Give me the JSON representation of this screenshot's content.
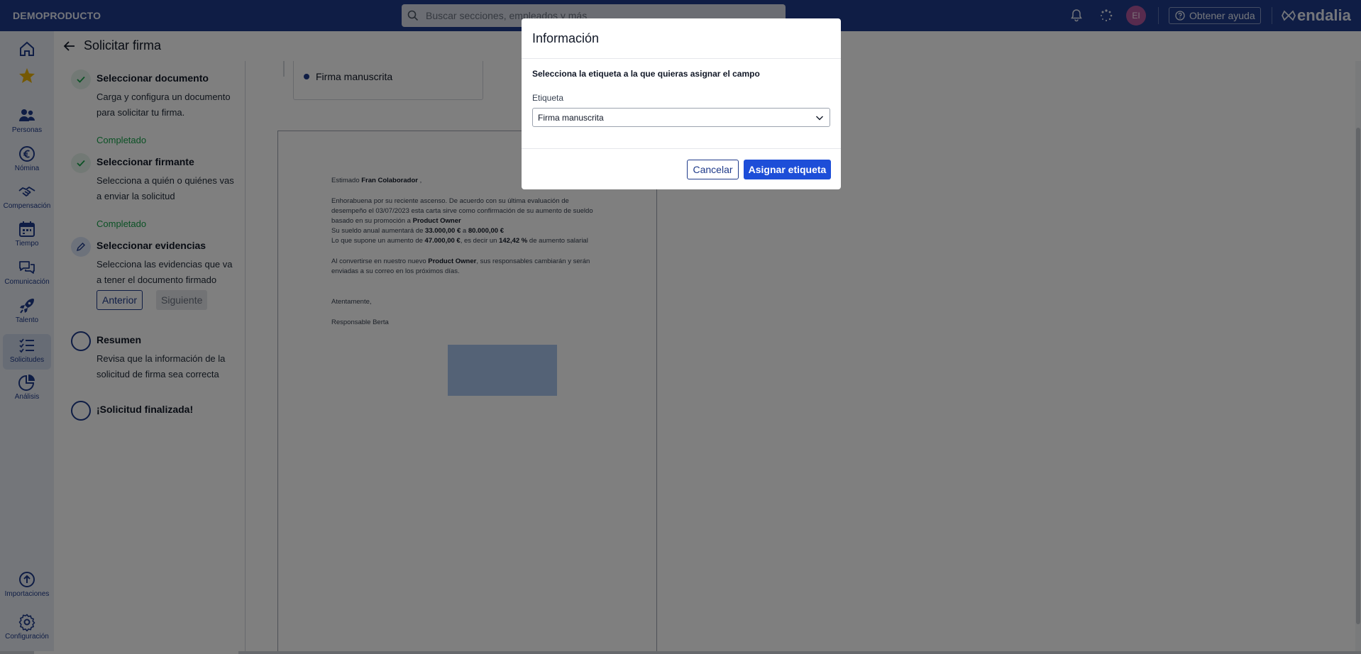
{
  "topbar": {
    "brand": "DEMOPRODUCTO",
    "search_placeholder": "Buscar secciones, empleados y más",
    "avatar_initials": "EI",
    "help_label": "Obtener ayuda",
    "logo_text": "endalia",
    "icons": [
      "search-icon",
      "bell-icon",
      "loading-icon",
      "help-circle-icon",
      "endalia-logo-icon"
    ]
  },
  "nav": {
    "items": [
      {
        "icon": "home-icon",
        "label": ""
      },
      {
        "icon": "star-icon",
        "label": ""
      },
      {
        "icon": "people-icon",
        "label": "Personas"
      },
      {
        "icon": "euro-icon",
        "label": "Nómina"
      },
      {
        "icon": "handshake-icon",
        "label": "Compensación"
      },
      {
        "icon": "calendar-icon",
        "label": "Tiempo"
      },
      {
        "icon": "chat-icon",
        "label": "Comunicación"
      },
      {
        "icon": "rocket-icon",
        "label": "Talento"
      },
      {
        "icon": "checklist-icon",
        "label": "Solicitudes"
      },
      {
        "icon": "pie-chart-icon",
        "label": "Análisis"
      },
      {
        "icon": "upload-icon",
        "label": "Importaciones"
      },
      {
        "icon": "gear-icon",
        "label": "Configuración"
      }
    ],
    "active": "Solicitudes"
  },
  "page": {
    "title": "Solicitar firma"
  },
  "steps": [
    {
      "title": "Seleccionar documento",
      "desc": "Carga y configura un documento para solicitar tu firma.",
      "status": "Completado",
      "state": "done"
    },
    {
      "title": "Seleccionar firmante",
      "desc": "Selecciona a quién o quiénes vas a enviar la solicitud",
      "status": "Completado",
      "state": "done"
    },
    {
      "title": "Seleccionar evidencias",
      "desc": "Selecciona las evidencias que va a tener el documento firmado",
      "state": "current",
      "prev_label": "Anterior",
      "next_label": "Siguiente"
    },
    {
      "title": "Resumen",
      "desc": "Revisa que la información de la solicitud de firma sea correcta",
      "state": "todo"
    },
    {
      "title": "¡Solicitud finalizada!",
      "state": "todo"
    }
  ],
  "content": {
    "tag_item": "Firma manuscrita",
    "document": {
      "greeting_prefix": "Estimado",
      "greeting_name": "Fran Colaborador",
      "greeting_suffix": ",",
      "p1_line1": "Enhorabuena por su reciente ascenso. De acuerdo con su última evaluación de",
      "p1_line2": "desempeño el 03/07/2023 esta carta sirve como confirmación de su aumento de sueldo",
      "p1_line3_prefix": "basado en su promoción a",
      "p1_line3_role": "Product Owner",
      "p1_line4_prefix": "Su sueldo anual aumentará de",
      "p1_line4_from": "33.000,00 €",
      "p1_line4_mid": "a",
      "p1_line4_to": "80.000,00 €",
      "p1_line5_prefix": "Lo que supone un aumento de",
      "p1_line5_amount": "47.000,00 €",
      "p1_line5_mid": ", es decir un",
      "p1_line5_pct": "142,42 %",
      "p1_line5_suffix": "de aumento salarial",
      "p2_line1_prefix": "Al convertirse en nuestro nuevo",
      "p2_line1_role": "Product Owner",
      "p2_line1_suffix": ", sus responsables cambiarán y serán",
      "p2_line2": "enviadas a su correo en los próximos días.",
      "closing": "Atentamente,",
      "signer": "Responsable Berta"
    }
  },
  "modal": {
    "title": "Información",
    "message": "Selecciona la etiqueta a la que quieras asignar el campo",
    "field_label": "Etiqueta",
    "selected_value": "Firma manuscrita",
    "cancel_label": "Cancelar",
    "assign_label": "Asignar etiqueta"
  },
  "colors": {
    "topbar": "#1e3a8a",
    "primary_button": "#1d4ed8",
    "completed": "#16a34a",
    "avatar": "#b0569d",
    "signature_field": "#a9c4ec"
  }
}
